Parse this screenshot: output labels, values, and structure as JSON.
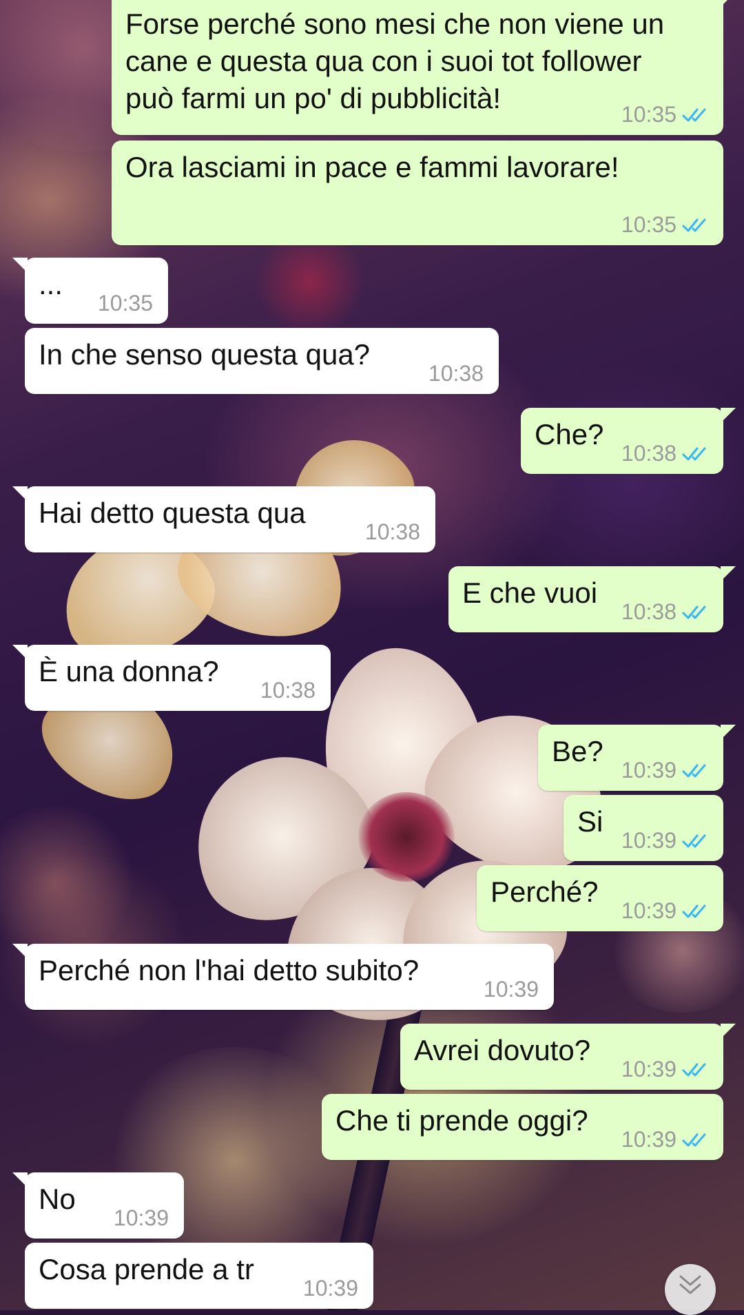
{
  "chat": {
    "messages": [
      {
        "dir": "out",
        "text": "Forse perché sono mesi che non viene un cane e questa qua con i suoi tot follower può farmi un po' di pubblicità!",
        "time": "10:35",
        "status": "read"
      },
      {
        "dir": "out",
        "text": "Ora lasciami in pace e fammi lavorare!",
        "time": "10:35",
        "status": "read"
      },
      {
        "dir": "in",
        "text": "...",
        "time": "10:35"
      },
      {
        "dir": "in",
        "text": "In che senso questa qua?",
        "time": "10:38"
      },
      {
        "dir": "out",
        "text": "Che?",
        "time": "10:38",
        "status": "read"
      },
      {
        "dir": "in",
        "text": "Hai detto questa qua",
        "time": "10:38"
      },
      {
        "dir": "out",
        "text": "E che vuoi",
        "time": "10:38",
        "status": "read"
      },
      {
        "dir": "in",
        "text": "È una donna?",
        "time": "10:38"
      },
      {
        "dir": "out",
        "text": "Be?",
        "time": "10:39",
        "status": "read"
      },
      {
        "dir": "out",
        "text": "Si",
        "time": "10:39",
        "status": "read"
      },
      {
        "dir": "out",
        "text": "Perché?",
        "time": "10:39",
        "status": "read"
      },
      {
        "dir": "in",
        "text": "Perché non l'hai detto subito?",
        "time": "10:39"
      },
      {
        "dir": "out",
        "text": "Avrei dovuto?",
        "time": "10:39",
        "status": "read"
      },
      {
        "dir": "out",
        "text": "Che ti prende oggi?",
        "time": "10:39",
        "status": "read"
      },
      {
        "dir": "in",
        "text": "No",
        "time": "10:39"
      },
      {
        "dir": "in",
        "text": "Cosa prende a tr",
        "time": "10:39"
      }
    ]
  },
  "icons": {
    "read_receipt": "double-check-icon",
    "scroll_down": "double-chevron-down-icon"
  },
  "colors": {
    "incoming_bubble": "#ffffff",
    "outgoing_bubble": "#e3ffc9",
    "read_tick": "#34b7f1",
    "timestamp": "#9a9a9a"
  }
}
